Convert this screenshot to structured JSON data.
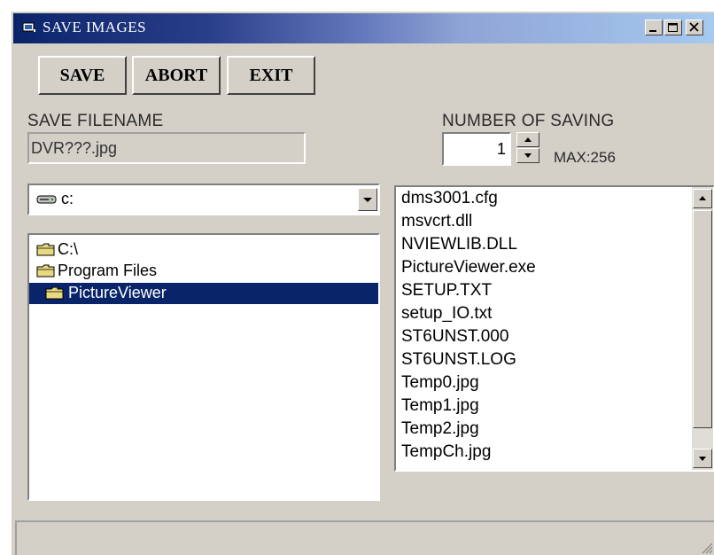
{
  "window": {
    "title": "SAVE IMAGES",
    "controls": [
      "minimize",
      "maximize",
      "close"
    ]
  },
  "toolbar": {
    "save_label": "SAVE",
    "abort_label": "ABORT",
    "exit_label": "EXIT"
  },
  "filename": {
    "label": "SAVE FILENAME",
    "value": "DVR???.jpg"
  },
  "saving": {
    "label": "NUMBER OF SAVING",
    "value": "1",
    "max_label": "MAX:256"
  },
  "drive": {
    "selected": "c:"
  },
  "tree": {
    "items": [
      {
        "label": "C:\\"
      },
      {
        "label": "Program Files"
      },
      {
        "label": "PictureViewer"
      }
    ]
  },
  "files": {
    "items": [
      "dms3001.cfg",
      "msvcrt.dll",
      "NVIEWLIB.DLL",
      "PictureViewer.exe",
      "SETUP.TXT",
      "setup_IO.txt",
      "ST6UNST.000",
      "ST6UNST.LOG",
      "Temp0.jpg",
      "Temp1.jpg",
      "Temp2.jpg",
      "TempCh.jpg"
    ]
  },
  "icons": {
    "title": "app-icon",
    "drive": "hard-drive-icon",
    "folder": "folder-icon",
    "dropdown": "chevron-down-icon",
    "spin_up": "arrow-up-icon",
    "spin_down": "arrow-down-icon",
    "resize": "resize-grip-icon"
  },
  "colors": {
    "face": "#d4d0c8",
    "selection": "#0a246a",
    "title_start": "#0a246a",
    "title_end": "#a6caf0"
  }
}
